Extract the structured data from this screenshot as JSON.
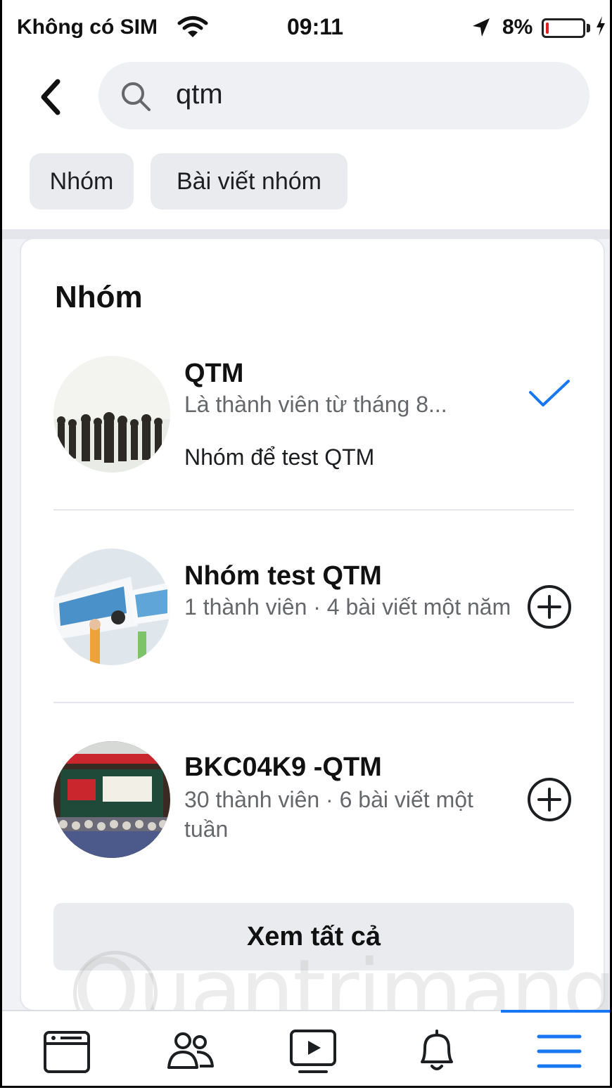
{
  "status_bar": {
    "carrier": "Không có SIM",
    "time": "09:11",
    "battery": "8%",
    "battery_level": 0.08,
    "icons": [
      "wifi-icon",
      "location-arrow-icon",
      "battery-icon",
      "charging-bolt-icon"
    ]
  },
  "header": {
    "back_icon": "chevron-left-icon",
    "search_icon": "search-icon",
    "search_value": "qtm"
  },
  "filters": [
    {
      "label": "Nhóm"
    },
    {
      "label": "Bài viết nhóm"
    }
  ],
  "section": {
    "title": "Nhóm",
    "groups": [
      {
        "name": "QTM",
        "meta": "Là thành viên từ tháng 8...",
        "description": "Nhóm để test QTM",
        "action_icon": "checkmark-icon"
      },
      {
        "name": "Nhóm test QTM",
        "meta": "1 thành viên · 4 bài viết một năm",
        "action_icon": "add-circle-icon"
      },
      {
        "name": "BKC04K9 -QTM",
        "meta": "30 thành viên · 6 bài viết một tuần",
        "action_icon": "add-circle-icon"
      }
    ],
    "see_all": "Xem tất cả"
  },
  "watermark": "Quantrimang",
  "tabbar": {
    "tabs": [
      {
        "icon": "news-feed-icon"
      },
      {
        "icon": "friends-icon"
      },
      {
        "icon": "watch-icon"
      },
      {
        "icon": "bell-icon"
      },
      {
        "icon": "menu-icon",
        "active": true
      }
    ]
  },
  "colors": {
    "accent": "#1877f2",
    "secondary_text": "#65676b",
    "chip_bg": "#e9ebee"
  }
}
